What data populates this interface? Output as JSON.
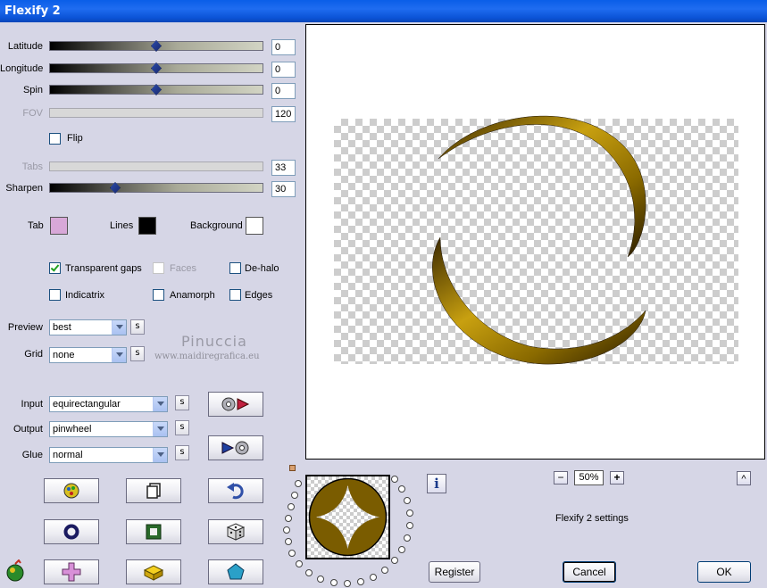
{
  "window": {
    "title": "Flexify 2"
  },
  "sliders": {
    "latitude": {
      "label": "Latitude",
      "value": "0",
      "position": 0.5
    },
    "longitude": {
      "label": "Longitude",
      "value": "0",
      "position": 0.5
    },
    "spin": {
      "label": "Spin",
      "value": "0",
      "position": 0.5
    },
    "fov": {
      "label": "FOV",
      "value": "120",
      "position": 1.0,
      "disabled": true
    },
    "tabs": {
      "label": "Tabs",
      "value": "33",
      "position": 0.33,
      "disabled": true
    },
    "sharpen": {
      "label": "Sharpen",
      "value": "30",
      "position": 0.3
    }
  },
  "flip": {
    "label": "Flip",
    "checked": false
  },
  "colors": {
    "tab": {
      "label": "Tab",
      "color": "#d8a8d8"
    },
    "lines": {
      "label": "Lines",
      "color": "#000000"
    },
    "background": {
      "label": "Background",
      "color": "#ffffff"
    }
  },
  "options": {
    "transparent_gaps": {
      "label": "Transparent gaps",
      "checked": true
    },
    "faces": {
      "label": "Faces",
      "checked": false,
      "disabled": true
    },
    "de_halo": {
      "label": "De-halo",
      "checked": false
    },
    "indicatrix": {
      "label": "Indicatrix",
      "checked": false
    },
    "anamorph": {
      "label": "Anamorph",
      "checked": false
    },
    "edges": {
      "label": "Edges",
      "checked": false
    }
  },
  "preview_select": {
    "label": "Preview",
    "value": "best"
  },
  "grid_select": {
    "label": "Grid",
    "value": "none"
  },
  "input_select": {
    "label": "Input",
    "value": "equirectangular"
  },
  "output_select": {
    "label": "Output",
    "value": "pinwheel"
  },
  "glue_select": {
    "label": "Glue",
    "value": "normal"
  },
  "s_label": "s",
  "watermark": {
    "name": "Pinuccia",
    "url": "www.maidiregrafica.eu"
  },
  "zoom": {
    "minus": "−",
    "value": "50%",
    "plus": "+"
  },
  "caret": "^",
  "info": "i",
  "settings_name": "Flexify 2 settings",
  "buttons": {
    "register": "Register",
    "cancel": "Cancel",
    "ok": "OK"
  },
  "accent": {
    "gold": "#b08a10",
    "titlebar": "#0a5ee8"
  }
}
